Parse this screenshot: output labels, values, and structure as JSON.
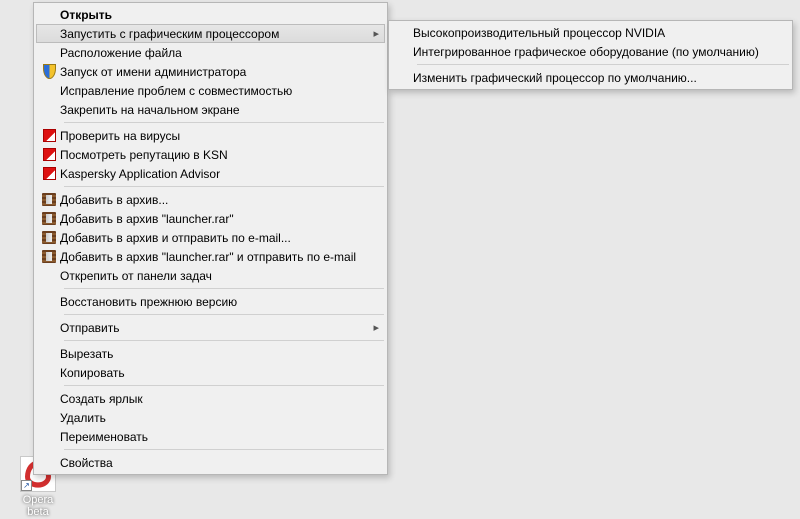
{
  "desktop_icon": {
    "label": "Opera beta",
    "icon": "opera-icon"
  },
  "main_menu": {
    "items": [
      {
        "label": "Открыть",
        "bold": true
      },
      {
        "label": "Запустить с графическим процессором",
        "has_sub": true,
        "highlight": true
      },
      {
        "label": "Расположение файла"
      },
      {
        "label": "Запуск от имени администратора",
        "icon": "shield-icon"
      },
      {
        "label": "Исправление проблем с совместимостью"
      },
      {
        "label": "Закрепить на начальном экране"
      },
      {
        "sep": true
      },
      {
        "label": "Проверить на вирусы",
        "icon": "kaspersky-icon"
      },
      {
        "label": "Посмотреть репутацию в KSN",
        "icon": "kaspersky-icon"
      },
      {
        "label": "Kaspersky Application Advisor",
        "icon": "kaspersky-icon"
      },
      {
        "sep": true
      },
      {
        "label": "Добавить в архив...",
        "icon": "winrar-icon"
      },
      {
        "label": "Добавить в архив \"launcher.rar\"",
        "icon": "winrar-icon"
      },
      {
        "label": "Добавить в архив и отправить по e-mail...",
        "icon": "winrar-icon"
      },
      {
        "label": "Добавить в архив \"launcher.rar\" и отправить по e-mail",
        "icon": "winrar-icon"
      },
      {
        "label": "Открепить от панели задач"
      },
      {
        "sep": true
      },
      {
        "label": "Восстановить прежнюю версию"
      },
      {
        "sep": true
      },
      {
        "label": "Отправить",
        "has_sub": true
      },
      {
        "sep": true
      },
      {
        "label": "Вырезать"
      },
      {
        "label": "Копировать"
      },
      {
        "sep": true
      },
      {
        "label": "Создать ярлык"
      },
      {
        "label": "Удалить"
      },
      {
        "label": "Переименовать"
      },
      {
        "sep": true
      },
      {
        "label": "Свойства"
      }
    ]
  },
  "sub_menu": {
    "items": [
      {
        "label": "Высокопроизводительный процессор NVIDIA"
      },
      {
        "label": "Интегрированное графическое оборудование (по умолчанию)"
      },
      {
        "sep": true
      },
      {
        "label": "Изменить графический процессор по умолчанию..."
      }
    ]
  }
}
